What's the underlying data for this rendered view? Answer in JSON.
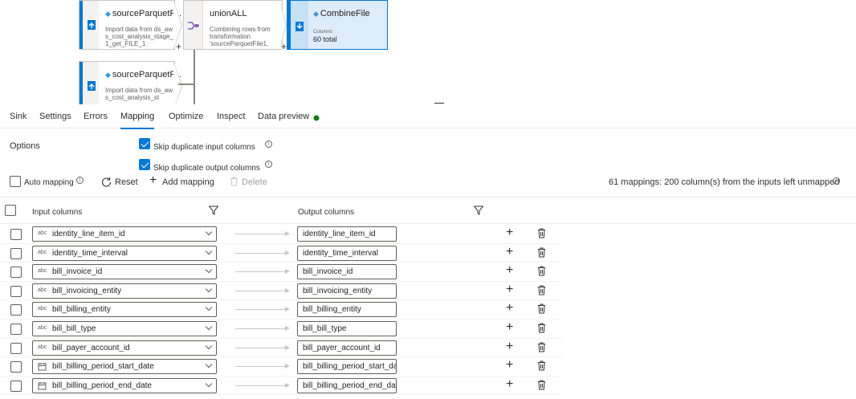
{
  "canvas": {
    "source1": {
      "title": "sourceParquetF...",
      "desc": "Import data from ds_aws_cost_analysis_stage_1_get_FILE_1",
      "plus": "+"
    },
    "union": {
      "title": "unionALL",
      "desc": "Combining rows from transformation 'sourceParquetFile1,",
      "plus": "+"
    },
    "sink": {
      "title": "CombineFile",
      "columns_label": "Columns:",
      "columns_value": "60 total"
    },
    "source2": {
      "title": "sourceParquetF...",
      "desc": "Import data from ds_aws_cost_analysis_st"
    }
  },
  "tabs": [
    "Sink",
    "Settings",
    "Errors",
    "Mapping",
    "Optimize",
    "Inspect",
    "Data preview"
  ],
  "active_tab": "Mapping",
  "status_color": "#107c10",
  "options": {
    "label": "Options",
    "skip_input": "Skip duplicate input columns",
    "skip_output": "Skip duplicate output columns"
  },
  "toolbar": {
    "auto_mapping": "Auto mapping",
    "reset": "Reset",
    "add_mapping": "Add mapping",
    "delete": "Delete",
    "summary": "61 mappings: 200 column(s) from the inputs left unmapped"
  },
  "table": {
    "input_header": "Input columns",
    "output_header": "Output columns",
    "rows": [
      {
        "type": "abc",
        "input": "identity_line_item_id",
        "output": "identity_line_item_id"
      },
      {
        "type": "abc",
        "input": "identity_time_interval",
        "output": "identity_time_interval"
      },
      {
        "type": "abc",
        "input": "bill_invoice_id",
        "output": "bill_invoice_id"
      },
      {
        "type": "abc",
        "input": "bill_invoicing_entity",
        "output": "bill_invoicing_entity"
      },
      {
        "type": "abc",
        "input": "bill_billing_entity",
        "output": "bill_billing_entity"
      },
      {
        "type": "abc",
        "input": "bill_bill_type",
        "output": "bill_bill_type"
      },
      {
        "type": "abc",
        "input": "bill_payer_account_id",
        "output": "bill_payer_account_id"
      },
      {
        "type": "date",
        "input": "bill_billing_period_start_date",
        "output": "bill_billing_period_start_date"
      },
      {
        "type": "date",
        "input": "bill_billing_period_end_date",
        "output": "bill_billing_period_end_date"
      }
    ]
  }
}
